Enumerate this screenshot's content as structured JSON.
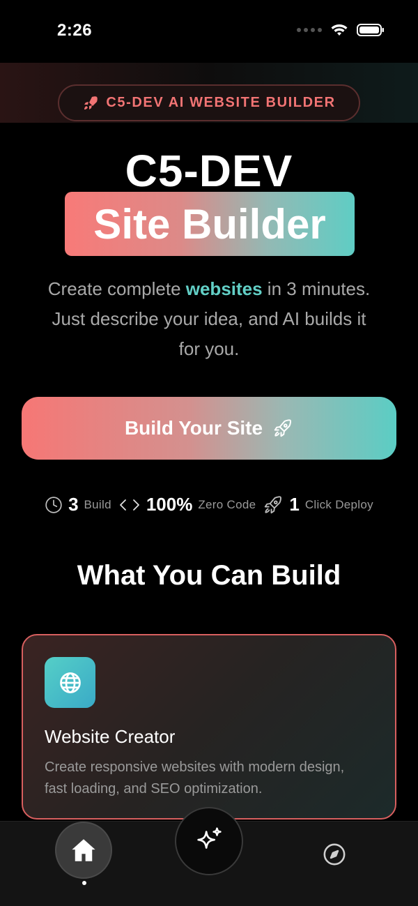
{
  "status_bar": {
    "time": "2:26"
  },
  "badge": {
    "icon": "rocket-icon",
    "text": "C5-DEV AI WEBSITE BUILDER"
  },
  "hero": {
    "title": "C5-DEV",
    "highlight_title": "Site Builder",
    "subtitle_before": "Create complete ",
    "subtitle_highlight": "websites",
    "subtitle_after": " in 3 minutes. Just describe your idea, and AI builds it for you."
  },
  "cta": {
    "label": "Build Your Site",
    "icon": "rocket-icon"
  },
  "stats": [
    {
      "icon": "clock-icon",
      "value": "3",
      "label": "Build"
    },
    {
      "icon": "code-icon",
      "value": "100%",
      "label": "Zero Code"
    },
    {
      "icon": "rocket-icon",
      "value": "1",
      "label": "Click Deploy"
    }
  ],
  "section": {
    "title": "What You Can Build"
  },
  "card": {
    "icon": "globe-icon",
    "title": "Website Creator",
    "description": "Create responsive websites with modern design, fast loading, and SEO optimization."
  },
  "nav": {
    "items": [
      {
        "icon": "home-icon",
        "active": true
      },
      {
        "icon": "sparkles-icon",
        "active": false
      },
      {
        "icon": "compass-icon",
        "active": false
      }
    ]
  },
  "colors": {
    "accent_coral": "#f87a78",
    "accent_teal": "#5fcdc4",
    "background": "#000000"
  }
}
